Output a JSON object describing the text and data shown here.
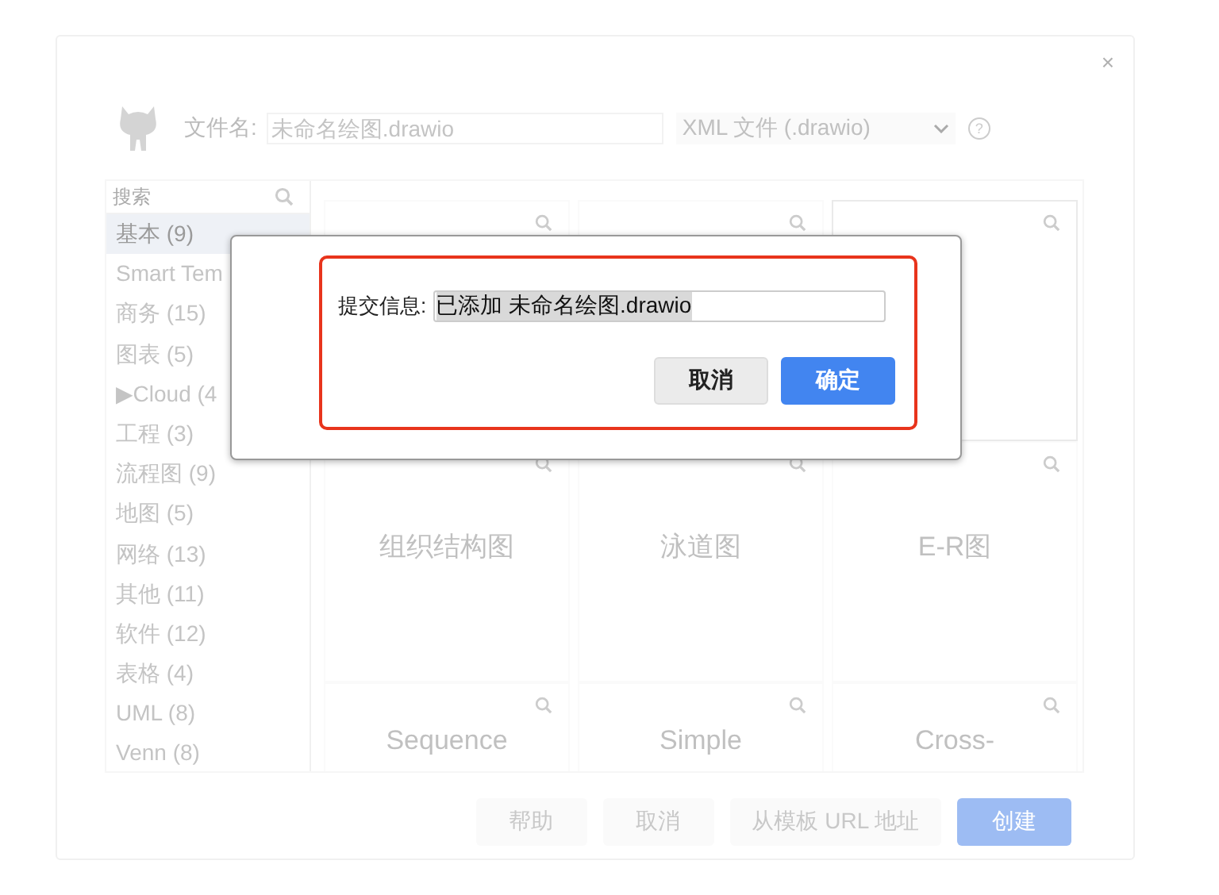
{
  "dialog": {
    "close": "×",
    "filename_label": "文件名:",
    "filename_placeholder": "未命名绘图.drawio",
    "format": "XML 文件 (.drawio)",
    "help_icon": "?"
  },
  "search": {
    "placeholder": "搜索"
  },
  "categories": [
    {
      "label": "基本 (9)",
      "selected": true
    },
    {
      "label": "Smart Tem",
      "selected": false
    },
    {
      "label": "商务 (15)",
      "selected": false
    },
    {
      "label": "图表 (5)",
      "selected": false
    },
    {
      "label": "Cloud (4",
      "selected": false,
      "expander": "▶"
    },
    {
      "label": "工程 (3)",
      "selected": false
    },
    {
      "label": "流程图 (9)",
      "selected": false
    },
    {
      "label": "地图 (5)",
      "selected": false
    },
    {
      "label": "网络 (13)",
      "selected": false
    },
    {
      "label": "其他 (11)",
      "selected": false
    },
    {
      "label": "软件 (12)",
      "selected": false
    },
    {
      "label": "表格 (4)",
      "selected": false
    },
    {
      "label": "UML (8)",
      "selected": false
    },
    {
      "label": "Venn (8)",
      "selected": false
    }
  ],
  "templates": [
    {
      "selected": false
    },
    {
      "selected": false
    },
    {
      "selected": true
    },
    {
      "label": "组织结构图",
      "selected": false
    },
    {
      "label": "泳道图",
      "selected": false
    },
    {
      "label": "E-R图",
      "selected": false
    },
    {
      "label": "Sequence",
      "selected": false
    },
    {
      "label": "Simple",
      "selected": false
    },
    {
      "label": "Cross-",
      "selected": false
    }
  ],
  "buttons": [
    {
      "label": "帮助",
      "kind": "plain"
    },
    {
      "label": "取消",
      "kind": "plain"
    },
    {
      "label": "从模板 URL 地址",
      "kind": "plain"
    },
    {
      "label": "创建",
      "kind": "primary"
    }
  ],
  "commit_dialog": {
    "label": "提交信息:",
    "value": "已添加 未命名绘图.drawio",
    "text_selected": true,
    "highlighted": true,
    "buttons": [
      {
        "label": "取消",
        "kind": "plain"
      },
      {
        "label": "确定",
        "kind": "primary"
      }
    ]
  }
}
